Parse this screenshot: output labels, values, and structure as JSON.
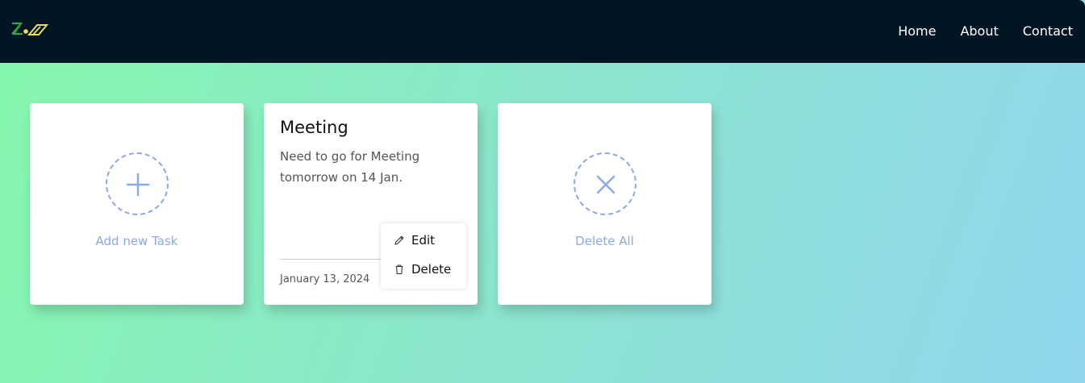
{
  "navbar": {
    "links": [
      {
        "label": "Home"
      },
      {
        "label": "About"
      },
      {
        "label": "Contact"
      }
    ],
    "background_color": "#011522"
  },
  "add_card": {
    "label": "Add new Task",
    "icon": "plus-icon"
  },
  "note_card": {
    "title": "Meeting",
    "body": "Need to go for Meeting tomorrow on 14 Jan.",
    "date": "January 13, 2024"
  },
  "context_menu": {
    "items": [
      {
        "label": "Edit",
        "icon": "pencil-icon"
      },
      {
        "label": "Delete",
        "icon": "trash-icon"
      }
    ]
  },
  "delete_all_card": {
    "label": "Delete All",
    "icon": "close-icon"
  },
  "colors": {
    "accent": "#8aa9ef"
  }
}
